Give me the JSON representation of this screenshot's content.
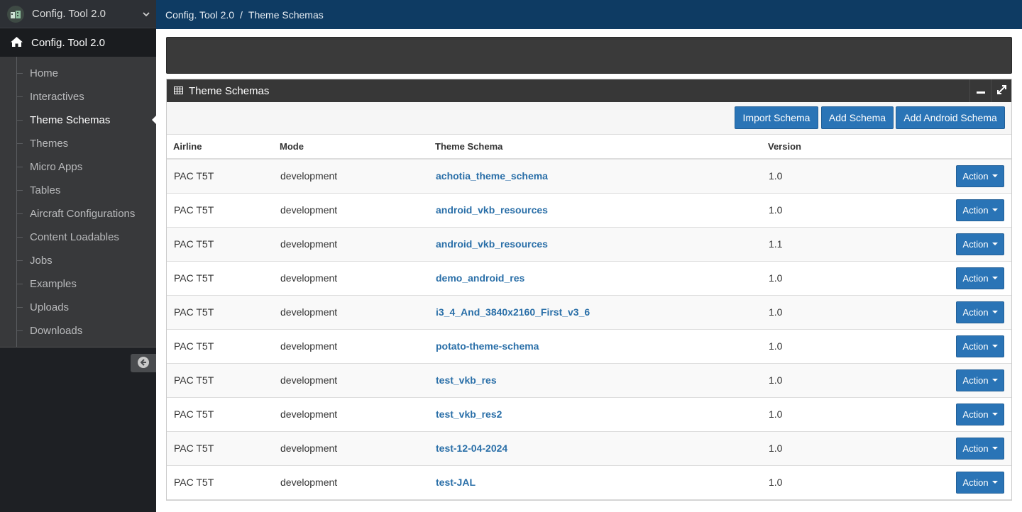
{
  "app": {
    "name": "Config. Tool 2.0",
    "home_label": "Config. Tool 2.0"
  },
  "nav": {
    "items": [
      {
        "label": "Home",
        "active": false
      },
      {
        "label": "Interactives",
        "active": false
      },
      {
        "label": "Theme Schemas",
        "active": true
      },
      {
        "label": "Themes",
        "active": false
      },
      {
        "label": "Micro Apps",
        "active": false
      },
      {
        "label": "Tables",
        "active": false
      },
      {
        "label": "Aircraft Configurations",
        "active": false
      },
      {
        "label": "Content Loadables",
        "active": false
      },
      {
        "label": "Jobs",
        "active": false
      },
      {
        "label": "Examples",
        "active": false
      },
      {
        "label": "Uploads",
        "active": false
      },
      {
        "label": "Downloads",
        "active": false
      }
    ]
  },
  "breadcrumb": {
    "root": "Config. Tool 2.0",
    "separator": "/",
    "current": "Theme Schemas"
  },
  "panel": {
    "title": "Theme Schemas",
    "icon": "table-icon"
  },
  "toolbar": {
    "import_label": "Import Schema",
    "add_label": "Add Schema",
    "add_android_label": "Add Android Schema"
  },
  "table": {
    "headers": [
      "Airline",
      "Mode",
      "Theme Schema",
      "Version"
    ],
    "action_label": "Action",
    "rows": [
      {
        "airline": "PAC T5T",
        "mode": "development",
        "schema": "achotia_theme_schema",
        "version": "1.0"
      },
      {
        "airline": "PAC T5T",
        "mode": "development",
        "schema": "android_vkb_resources",
        "version": "1.0"
      },
      {
        "airline": "PAC T5T",
        "mode": "development",
        "schema": "android_vkb_resources",
        "version": "1.1"
      },
      {
        "airline": "PAC T5T",
        "mode": "development",
        "schema": "demo_android_res",
        "version": "1.0"
      },
      {
        "airline": "PAC T5T",
        "mode": "development",
        "schema": "i3_4_And_3840x2160_First_v3_6",
        "version": "1.0"
      },
      {
        "airline": "PAC T5T",
        "mode": "development",
        "schema": "potato-theme-schema",
        "version": "1.0"
      },
      {
        "airline": "PAC T5T",
        "mode": "development",
        "schema": "test_vkb_res",
        "version": "1.0"
      },
      {
        "airline": "PAC T5T",
        "mode": "development",
        "schema": "test_vkb_res2",
        "version": "1.0"
      },
      {
        "airline": "PAC T5T",
        "mode": "development",
        "schema": "test-12-04-2024",
        "version": "1.0"
      },
      {
        "airline": "PAC T5T",
        "mode": "development",
        "schema": "test-JAL",
        "version": "1.0"
      }
    ]
  },
  "colors": {
    "topbar": "#0e3b63",
    "sidebar": "#1e2024",
    "primary_button": "#2a74b6",
    "link": "#2a6fa8",
    "panel_header": "#373737"
  }
}
